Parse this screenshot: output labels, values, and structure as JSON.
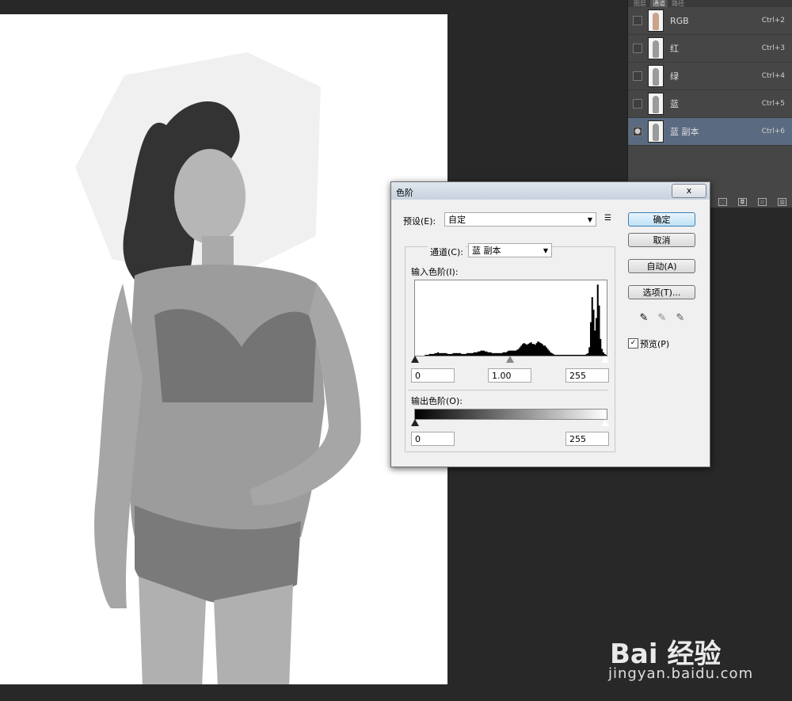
{
  "channels_panel": {
    "tabs": [
      "图层",
      "通道",
      "路径"
    ],
    "active_tab": "通道",
    "rows": [
      {
        "name": "RGB",
        "shortcut": "Ctrl+2",
        "visible": false,
        "selected": false
      },
      {
        "name": "红",
        "shortcut": "Ctrl+3",
        "visible": false,
        "selected": false
      },
      {
        "name": "绿",
        "shortcut": "Ctrl+4",
        "visible": false,
        "selected": false
      },
      {
        "name": "蓝",
        "shortcut": "Ctrl+5",
        "visible": false,
        "selected": false
      },
      {
        "name": "蓝 副本",
        "shortcut": "Ctrl+6",
        "visible": true,
        "selected": true
      }
    ]
  },
  "levels_dialog": {
    "title": "色阶",
    "close_label": "x",
    "preset_label": "预设(E):",
    "preset_value": "自定",
    "channel_label": "通道(C):",
    "channel_value": "蓝 副本",
    "input_label": "输入色阶(I):",
    "input_black": "0",
    "input_gamma": "1.00",
    "input_white": "255",
    "output_label": "输出色阶(O):",
    "output_black": "0",
    "output_white": "255",
    "buttons": {
      "ok": "确定",
      "cancel": "取消",
      "auto": "自动(A)",
      "options": "选项(T)..."
    },
    "preview_label": "预览(P)",
    "preview_checked": true,
    "histogram_levels": [
      0,
      0,
      0,
      0,
      0,
      0,
      0,
      1,
      1,
      1,
      2,
      2,
      2,
      2,
      3,
      3,
      4,
      3,
      3,
      3,
      3,
      3,
      3,
      2,
      2,
      2,
      2,
      3,
      3,
      3,
      3,
      3,
      3,
      2,
      2,
      2,
      2,
      3,
      3,
      3,
      3,
      3,
      4,
      4,
      4,
      5,
      5,
      6,
      6,
      6,
      5,
      5,
      4,
      4,
      4,
      3,
      3,
      3,
      3,
      3,
      3,
      3,
      3,
      4,
      4,
      4,
      5,
      6,
      6,
      6,
      6,
      6,
      6,
      7,
      8,
      10,
      12,
      14,
      15,
      14,
      13,
      14,
      15,
      16,
      14,
      14,
      13,
      15,
      17,
      16,
      15,
      14,
      12,
      12,
      10,
      8,
      6,
      4,
      3,
      2,
      1,
      1,
      1,
      1,
      1,
      1,
      1,
      1,
      1,
      1,
      1,
      1,
      1,
      1,
      1,
      1,
      1,
      1,
      1,
      1,
      1,
      1,
      1,
      2,
      3,
      10,
      40,
      70,
      55,
      30,
      45,
      85,
      60,
      20,
      8,
      4,
      2,
      1
    ],
    "colors": {
      "histogram": "#000000",
      "default_button": "#3c7fb1"
    }
  },
  "watermark": {
    "main": "Bai 经验",
    "sub": "jingyan.baidu.com"
  }
}
